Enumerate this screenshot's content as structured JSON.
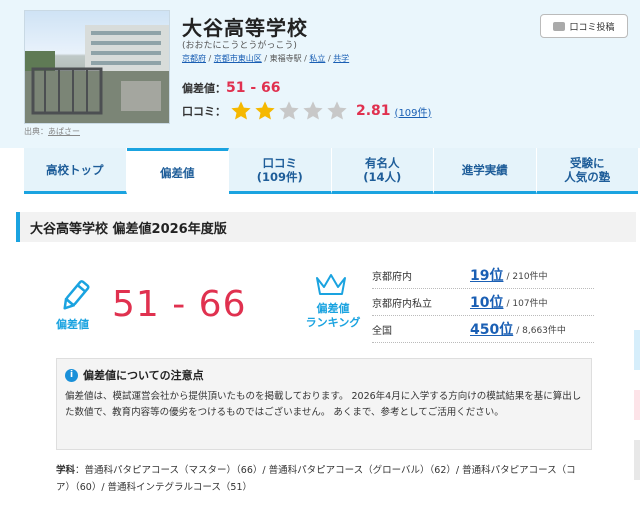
{
  "school": {
    "name": "大谷高等学校",
    "kana": "(おおたにこうとうがっこう)",
    "location": {
      "prefecture": "京都府",
      "city": "京都市東山区",
      "station": "東福寺駅",
      "type": "私立",
      "gender": "共学",
      "sep": "/"
    },
    "photo_credit_label": "出典：",
    "photo_credit_name": "あぱさー",
    "deviation_label": "偏差値：",
    "deviation_value": "51 - 66",
    "review_label": "口コミ：",
    "rating": "2.81",
    "rating_value": 2.81,
    "rating_max": 5,
    "review_count": "(109件)"
  },
  "review_button_label": "口コミ投稿",
  "tabs": [
    {
      "line1": "高校トップ",
      "line2": ""
    },
    {
      "line1": "偏差値",
      "line2": ""
    },
    {
      "line1": "口コミ",
      "line2": "(109件)"
    },
    {
      "line1": "有名人",
      "line2": "(14人)"
    },
    {
      "line1": "進学実績",
      "line2": ""
    },
    {
      "line1": "受験に",
      "line2": "人気の塾"
    }
  ],
  "section_title": "大谷高等学校 偏差値2026年度版",
  "deviation_block": {
    "label": "偏差値",
    "value": "51 - 66",
    "ranking_label_1": "偏差値",
    "ranking_label_2": "ランキング"
  },
  "rankings": [
    {
      "name": "京都府内",
      "rank": "19位",
      "total": "/ 210件中"
    },
    {
      "name": "京都府内私立",
      "rank": "10位",
      "total": "/ 107件中"
    },
    {
      "name": "全国",
      "rank": "450位",
      "total": "/ 8,663件中"
    }
  ],
  "notice": {
    "title": "偏差値についての注意点",
    "body": "偏差値は、模試運営会社から提供頂いたものを掲載しております。 2026年4月に入学する方向けの模試結果を基に算出した数値で、教育内容等の優劣をつけるものではございません。 あくまで、参考としてご活用ください。"
  },
  "courses": {
    "label": "学科",
    "colon": "：",
    "text": "普通科パタピアコース（マスター）（66）/ 普通科パタピアコース（グローバル）（62）/ 普通科パタピアコース（コア）（60）/ 普通科インテグラルコース（51）"
  },
  "colors": {
    "accent_blue": "#1aa3e0",
    "link_blue": "#1a5fb4",
    "value_red": "#e0314f",
    "star_gold": "#f5b800",
    "star_gray": "#c8c8c8"
  }
}
